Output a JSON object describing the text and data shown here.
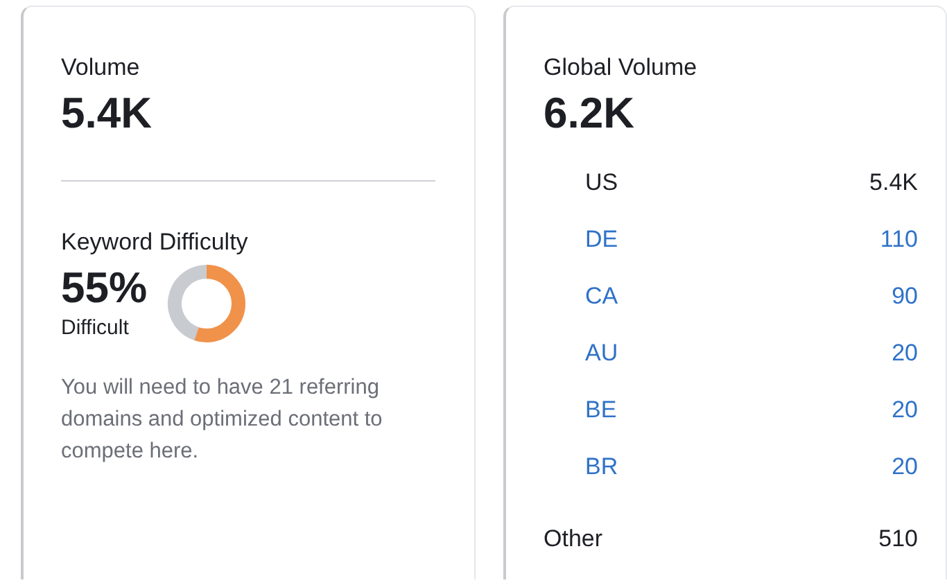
{
  "volume_card": {
    "label": "Volume",
    "value": "5.4K",
    "difficulty": {
      "label": "Keyword Difficulty",
      "value": "55%",
      "rating": "Difficult",
      "level": 0.55,
      "note": "You will need to have 21 referring domains and optimized content to compete here."
    }
  },
  "global_card": {
    "label": "Global Volume",
    "value": "6.2K",
    "countries": [
      {
        "code": "US",
        "volume": "5.4K",
        "linked": false
      },
      {
        "code": "DE",
        "volume": "110",
        "linked": true
      },
      {
        "code": "CA",
        "volume": "90",
        "linked": true
      },
      {
        "code": "AU",
        "volume": "20",
        "linked": true
      },
      {
        "code": "BE",
        "volume": "20",
        "linked": true
      },
      {
        "code": "BR",
        "volume": "20",
        "linked": true
      }
    ],
    "other": {
      "label": "Other",
      "volume": "510"
    }
  }
}
